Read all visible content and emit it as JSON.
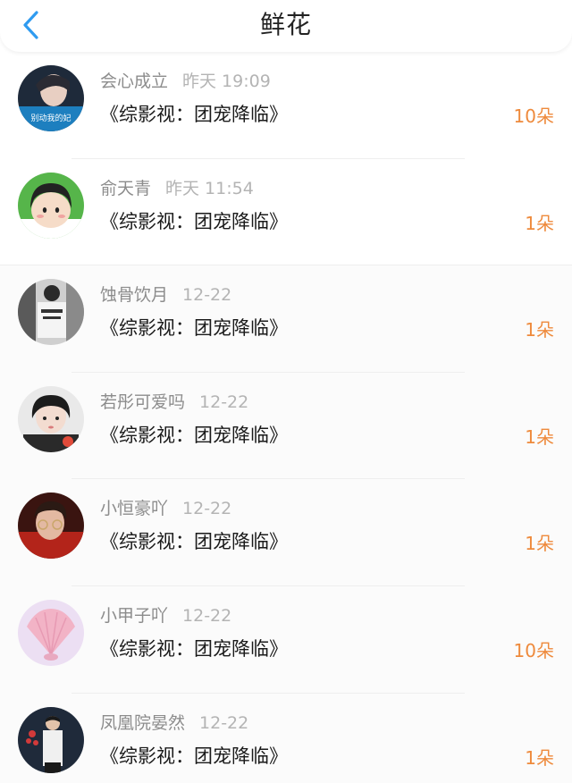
{
  "header": {
    "title": "鲜花",
    "back_icon": "chevron-left-icon",
    "accent_color": "#2f9bf0"
  },
  "count_color": "#ee8a3c",
  "rows": [
    {
      "username": "会心成立",
      "time": "昨天 19:09",
      "work": "《综影视：团宠降临》",
      "count": "10朵",
      "avatar_text": "别动我的妃"
    },
    {
      "username": "俞天青",
      "time": "昨天 11:54",
      "work": "《综影视：团宠降临》",
      "count": "1朵"
    },
    {
      "username": "蚀骨饮月",
      "time": "12-22",
      "work": "《综影视：团宠降临》",
      "count": "1朵"
    },
    {
      "username": "若彤可爱吗",
      "time": "12-22",
      "work": "《综影视：团宠降临》",
      "count": "1朵"
    },
    {
      "username": "小恒豪吖",
      "time": "12-22",
      "work": "《综影视：团宠降临》",
      "count": "1朵"
    },
    {
      "username": "小甲子吖",
      "time": "12-22",
      "work": "《综影视：团宠降临》",
      "count": "10朵"
    },
    {
      "username": "凤凰院晏然",
      "time": "12-22",
      "work": "《综影视：团宠降临》",
      "count": "1朵"
    }
  ]
}
